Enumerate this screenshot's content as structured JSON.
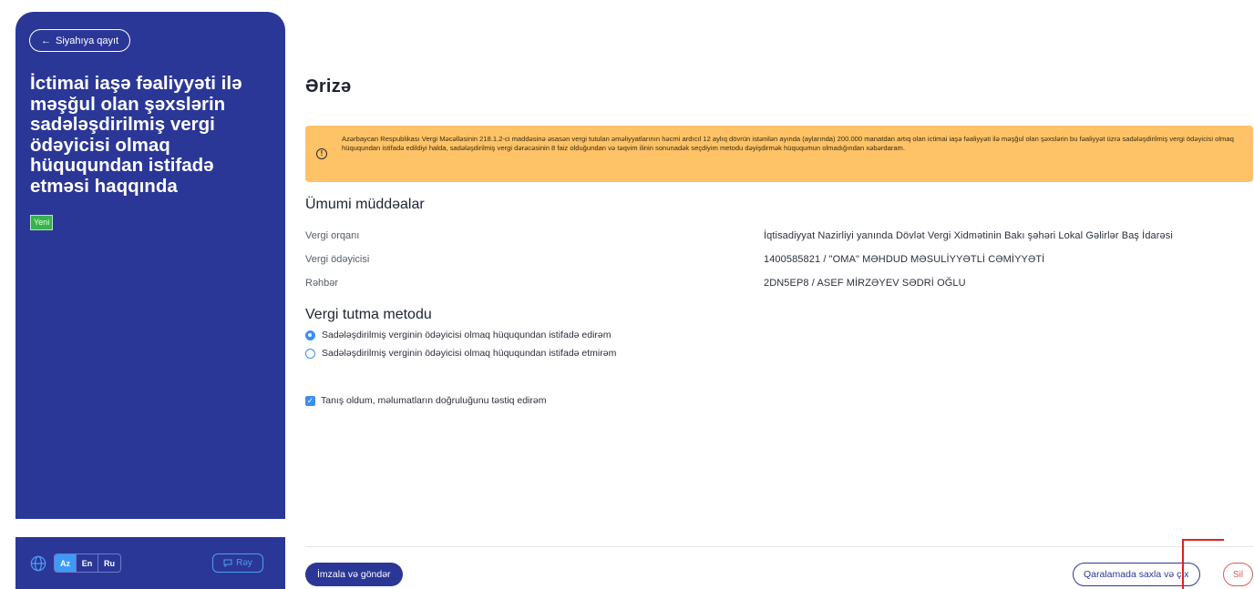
{
  "sidebar": {
    "back_label": "Siyahıya qayıt",
    "title": "İctimai iaşə fəaliyyəti ilə məşğul olan şəxslərin sadələşdirilmiş vergi ödəyicisi olmaq hüququndan istifadə etməsi haqqında",
    "badge": "Yeni",
    "languages": [
      "Az",
      "En",
      "Ru"
    ],
    "active_language": "Az",
    "feedback_label": "Rəy"
  },
  "main": {
    "title": "Ərizə",
    "alert_text": "Azərbaycan Respublikası Vergi Məcəlləsinin 218.1.2-ci maddəsinə əsasən vergi tutulan əməliyyatlarının həcmi ardıcıl 12 aylıq dövrün istənilən ayında (aylarında) 200.000 manatdan artıq olan ictimai iaşə fəaliyyəti ilə məşğul olan şəxslərin bu fəaliyyət üzrə sadələşdirilmiş vergi ödəyicisi olmaq hüququndan istifadə edildiyi halda, sadələşdirilmiş vergi dərəcəsinin 8 faiz olduğundan və təqvim ilinin sonunadək seçdiyim metodu dəyişdirmək hüququmun olmadığından xəbərdaram.",
    "general": {
      "title": "Ümumi müddəalar",
      "rows": [
        {
          "label": "Vergi orqanı",
          "value": "İqtisadiyyat Nazirliyi yanında Dövlət Vergi Xidmətinin Bakı şəhəri Lokal Gəlirlər Baş İdarəsi"
        },
        {
          "label": "Vergi ödəyicisi",
          "value": "1400585821 / \"OMA\" MƏHDUD MƏSULİYYƏTLİ CƏMİYYƏTİ"
        },
        {
          "label": "Rəhbər",
          "value": "2DN5EP8 / ASEF MİRZƏYEV SƏDRİ OĞLU"
        }
      ]
    },
    "method": {
      "title": "Vergi tutma metodu",
      "options": [
        {
          "label": "Sadələşdirilmiş verginin ödəyicisi olmaq hüququndan istifadə edirəm",
          "selected": true
        },
        {
          "label": "Sadələşdirilmiş verginin ödəyicisi olmaq hüququndan istifadə etmirəm",
          "selected": false
        }
      ]
    },
    "confirm_label": "Tanış oldum, məlumatların doğruluğunu təstiq edirəm",
    "confirm_checked": true,
    "actions": {
      "sign_send": "İmzala və göndər",
      "save_draft": "Qaralamada saxla və çıx",
      "delete": "Sil"
    }
  },
  "colors": {
    "sidebar_bg": "#2b3797",
    "alert_bg": "#fec267",
    "accent": "#3a8ff4",
    "delete": "#e05a5a"
  }
}
